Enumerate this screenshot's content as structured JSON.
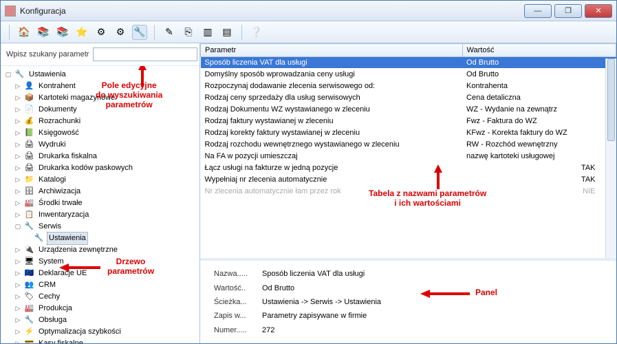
{
  "window": {
    "title": "Konfiguracja"
  },
  "search": {
    "label": "Wpisz szukany parametr",
    "value": ""
  },
  "toolbar_icons": [
    "home",
    "stack1",
    "stack2",
    "star",
    "gear1",
    "gear2",
    "wrench",
    "edit",
    "copy",
    "layers",
    "stack3",
    "help"
  ],
  "tree": {
    "root": "Ustawienia",
    "items": [
      "Kontrahent",
      "Kartoteki magazynowe",
      "Dokumenty",
      "Rozrachunki",
      "Księgowość",
      "Wydruki",
      "Drukarka fiskalna",
      "Drukarka kodów paskowych",
      "Katalogi",
      "Archiwizacja",
      "Środki trwałe",
      "Inwentaryzacja"
    ],
    "serwis_label": "Serwis",
    "serwis_child": "Ustawienia",
    "items2": [
      "Urządzenia zewnętrzne",
      "System",
      "Deklaracje UE",
      "CRM",
      "Cechy",
      "Produkcja",
      "Obsługa",
      "Optymalizacja szybkości",
      "Kasy fiskalne"
    ]
  },
  "table": {
    "columns": [
      "Parametr",
      "Wartość"
    ],
    "rows": [
      {
        "p": "Sposób liczenia VAT dla usługi",
        "v": "Od Brutto",
        "sel": true
      },
      {
        "p": "Domyślny sposób wprowadzania ceny usługi",
        "v": "Od Brutto"
      },
      {
        "p": "Rozpoczynaj dodawanie zlecenia serwisowego od:",
        "v": "Kontrahenta"
      },
      {
        "p": "Rodzaj ceny sprzedaży dla usług serwisowych",
        "v": "Cena detaliczna"
      },
      {
        "p": "Rodzaj Dokumentu WZ wystawianego w zleceniu",
        "v": "WZ - Wydanie na zewnątrz"
      },
      {
        "p": "Rodzaj faktury wystawianej w zleceniu",
        "v": "Fwz - Faktura do WZ"
      },
      {
        "p": "Rodzaj korekty faktury wystawianej w zleceniu",
        "v": "KFwz - Korekta faktury do WZ"
      },
      {
        "p": "Rodzaj rozchodu wewnętrznego wystawianego w zleceniu",
        "v": "RW - Rozchód wewnętrzny"
      },
      {
        "p": "Na FA w pozycji umieszczaj",
        "v": "nazwę kartoteki usługowej"
      },
      {
        "p": "Łącz usługi na fakturze w jedną pozycje",
        "v": "TAK",
        "right": true
      },
      {
        "p": "Wypełniaj nr zlecenia automatycznie",
        "v": "TAK",
        "right": true
      },
      {
        "p": "Nr zlecenia automatycznie łam przez rok",
        "v": "NIE",
        "right": true,
        "disabled": true
      }
    ]
  },
  "details": {
    "k1": "Nazwa.....",
    "v1": "Sposób liczenia VAT dla usługi",
    "k2": "Wartość..",
    "v2": "Od Brutto",
    "k3": "Ścieżka...",
    "v3": "Ustawienia -> Serwis -> Ustawienia",
    "k4": "Zapis w...",
    "v4": "Parametry zapisywane w firmie",
    "k5": "Numer.....",
    "v5": "272"
  },
  "annotations": {
    "a1": "Pole edycyjne\ndo wyszukiwania\nparametrów",
    "a2": "Drzewo\nparametrów",
    "a3": "Tabela z nazwami parametrów\ni ich wartościami",
    "a4": "Panel"
  }
}
